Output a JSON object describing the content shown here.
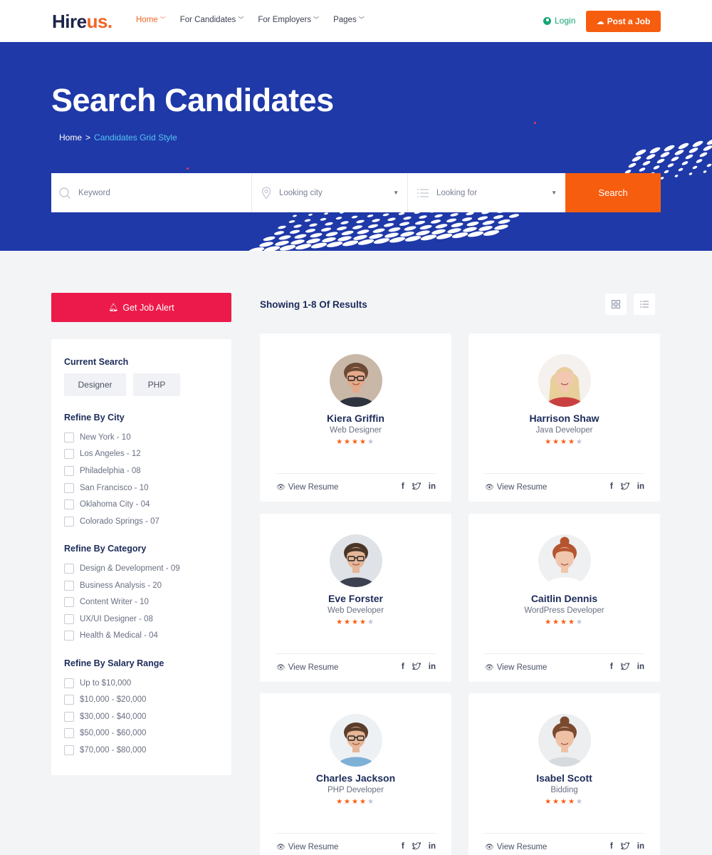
{
  "header": {
    "logo_main": "Hire",
    "logo_accent": "us.",
    "nav": [
      "Home",
      "For Candidates",
      "For Employers",
      "Pages"
    ],
    "login": "Login",
    "post_job": "Post a Job"
  },
  "hero": {
    "title": "Search Candidates",
    "breadcrumb_home": "Home",
    "breadcrumb_sep": ">",
    "breadcrumb_current": "Candidates Grid Style"
  },
  "search": {
    "keyword_placeholder": "Keyword",
    "city_placeholder": "Looking city",
    "category_placeholder": "Looking for",
    "button": "Search"
  },
  "sidebar": {
    "alert_button": "Get Job Alert",
    "current_search_title": "Current Search",
    "current_tags": [
      "Designer",
      "PHP"
    ],
    "city_title": "Refine By City",
    "cities": [
      "New York - 10",
      "Los Angeles - 12",
      "Philadelphia - 08",
      "San Francisco - 10",
      "Oklahoma City - 04",
      "Colorado Springs - 07"
    ],
    "category_title": "Refine By Category",
    "categories": [
      "Design & Development - 09",
      "Business Analysis - 20",
      "Content Writer - 10",
      "UX/UI Designer - 08",
      "Health & Medical - 04"
    ],
    "salary_title": "Refine By Salary Range",
    "salaries": [
      "Up to $10,000",
      "$10,000 - $20,000",
      "$30,000 - $40,000",
      "$50,000 - $60,000",
      "$70,000 - $80,000"
    ]
  },
  "results": {
    "title": "Showing 1-8 Of Results",
    "view_resume": "View Resume",
    "social_icons": [
      "facebook-icon",
      "twitter-icon",
      "linkedin-icon"
    ],
    "candidates": [
      {
        "name": "Kiera Griffin",
        "role": "Web Designer",
        "rating": 4,
        "max": 5
      },
      {
        "name": "Harrison Shaw",
        "role": "Java Developer",
        "rating": 4,
        "max": 5
      },
      {
        "name": "Eve Forster",
        "role": "Web Developer",
        "rating": 4,
        "max": 5
      },
      {
        "name": "Caitlin Dennis",
        "role": "WordPress Developer",
        "rating": 4,
        "max": 5
      },
      {
        "name": "Charles Jackson",
        "role": "PHP Developer",
        "rating": 4,
        "max": 5
      },
      {
        "name": "Isabel Scott",
        "role": "Bidding",
        "rating": 4,
        "max": 5
      }
    ]
  },
  "colors": {
    "primary_blue": "#1f39a8",
    "accent_orange": "#f75d0f",
    "alert_red": "#ec1a4a",
    "link_cyan": "#55c3f5",
    "login_green": "#17a673"
  }
}
